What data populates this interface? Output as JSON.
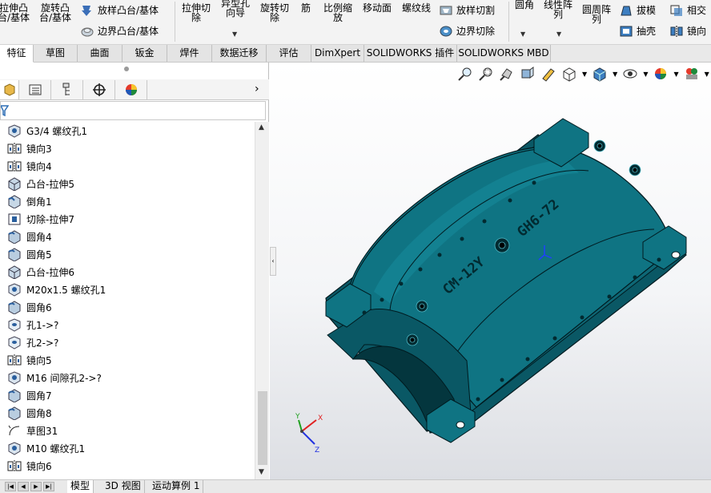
{
  "ribbon": {
    "items": [
      {
        "label1": "拉伸凸",
        "label2": "台/基体"
      },
      {
        "label1": "旋转凸",
        "label2": "台/基体"
      },
      {
        "label": "放样凸台/基体"
      },
      {
        "label": "边界凸台/基体"
      },
      {
        "label1": "拉伸切",
        "label2": "除"
      },
      {
        "label1": "异型孔",
        "label2": "向导"
      },
      {
        "label1": "旋转切",
        "label2": "除"
      },
      {
        "label": "筋"
      },
      {
        "label1": "比例缩",
        "label2": "放"
      },
      {
        "label": "移动面"
      },
      {
        "label": "螺纹线"
      },
      {
        "label": "放样切割"
      },
      {
        "label": "边界切除"
      },
      {
        "label": "圆角"
      },
      {
        "label1": "线性阵",
        "label2": "列"
      },
      {
        "label1": "圆周阵",
        "label2": "列"
      },
      {
        "label": "拔模"
      },
      {
        "label": "抽壳"
      },
      {
        "label": "相交"
      },
      {
        "label": "镜向"
      }
    ]
  },
  "tabs": [
    "特征",
    "草图",
    "曲面",
    "钣金",
    "焊件",
    "数据迁移",
    "评估",
    "DimXpert",
    "SOLIDWORKS 插件",
    "SOLIDWORKS MBD"
  ],
  "feature_tree": [
    {
      "label": "G3/4 螺纹孔1",
      "icon": "hole-wizard-icon"
    },
    {
      "label": "镜向3",
      "icon": "mirror-icon"
    },
    {
      "label": "镜向4",
      "icon": "mirror-icon"
    },
    {
      "label": "凸台-拉伸5",
      "icon": "boss-extrude-icon"
    },
    {
      "label": "倒角1",
      "icon": "chamfer-icon"
    },
    {
      "label": "切除-拉伸7",
      "icon": "cut-extrude-icon"
    },
    {
      "label": "圆角4",
      "icon": "fillet-icon"
    },
    {
      "label": "圆角5",
      "icon": "fillet-icon"
    },
    {
      "label": "凸台-拉伸6",
      "icon": "boss-extrude-icon"
    },
    {
      "label": "M20x1.5 螺纹孔1",
      "icon": "hole-wizard-icon"
    },
    {
      "label": "圆角6",
      "icon": "fillet-icon"
    },
    {
      "label": "孔1->?",
      "icon": "hole-icon"
    },
    {
      "label": "孔2->?",
      "icon": "hole-icon"
    },
    {
      "label": "镜向5",
      "icon": "mirror-icon"
    },
    {
      "label": "M16 间隙孔2->?",
      "icon": "hole-wizard-icon"
    },
    {
      "label": "圆角7",
      "icon": "fillet-icon"
    },
    {
      "label": "圆角8",
      "icon": "fillet-icon"
    },
    {
      "label": "草图31",
      "icon": "sketch-icon"
    },
    {
      "label": "M10 螺纹孔1",
      "icon": "hole-wizard-icon"
    },
    {
      "label": "镜向6",
      "icon": "mirror-icon"
    }
  ],
  "model": {
    "engraving_left": "CM-12Y",
    "engraving_right": "GH6-72",
    "color": "#0d6a78"
  },
  "triad": {
    "x": "X",
    "y": "Y",
    "z": "Z"
  },
  "bottom_tabs": [
    "模型",
    "3D 视图",
    "运动算例 1"
  ],
  "colors": {
    "accent": "#1a8fd8",
    "model": "#0d6a78",
    "ribbon_bg": "#f3f3f3"
  }
}
